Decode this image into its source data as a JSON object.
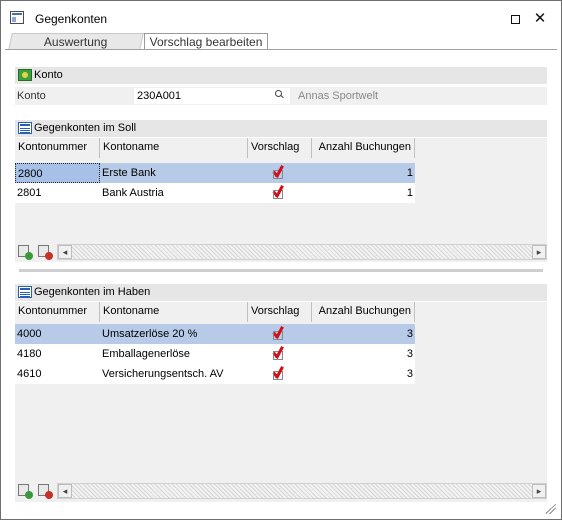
{
  "window": {
    "title": "Gegenkonten"
  },
  "tabs": [
    {
      "label": "Auswertung",
      "active": false
    },
    {
      "label": "Vorschlag bearbeiten",
      "active": true
    }
  ],
  "konto_section": {
    "header": "Konto",
    "field_label": "Konto",
    "value": "230A001",
    "account_name": "Annas Sportwelt"
  },
  "soll": {
    "header": "Gegenkonten im Soll",
    "columns": [
      "Kontonummer",
      "Kontoname",
      "Vorschlag",
      "Anzahl Buchungen"
    ],
    "rows": [
      {
        "nr": "2800",
        "name": "Erste Bank",
        "vorschlag": true,
        "anzahl": "1"
      },
      {
        "nr": "2801",
        "name": "Bank Austria",
        "vorschlag": true,
        "anzahl": "1"
      }
    ]
  },
  "haben": {
    "header": "Gegenkonten im Haben",
    "columns": [
      "Kontonummer",
      "Kontoname",
      "Vorschlag",
      "Anzahl Buchungen"
    ],
    "rows": [
      {
        "nr": "4000",
        "name": "Umsatzerlöse 20 %",
        "vorschlag": true,
        "anzahl": "3"
      },
      {
        "nr": "4180",
        "name": "Emballagenerlöse",
        "vorschlag": true,
        "anzahl": "3"
      },
      {
        "nr": "4610",
        "name": "Versicherungsentsch. AV",
        "vorschlag": true,
        "anzahl": "3"
      }
    ]
  },
  "colors": {
    "selection": "#b7cbe8",
    "header_bg": "#e6e6e6",
    "check": "#d0101a"
  }
}
